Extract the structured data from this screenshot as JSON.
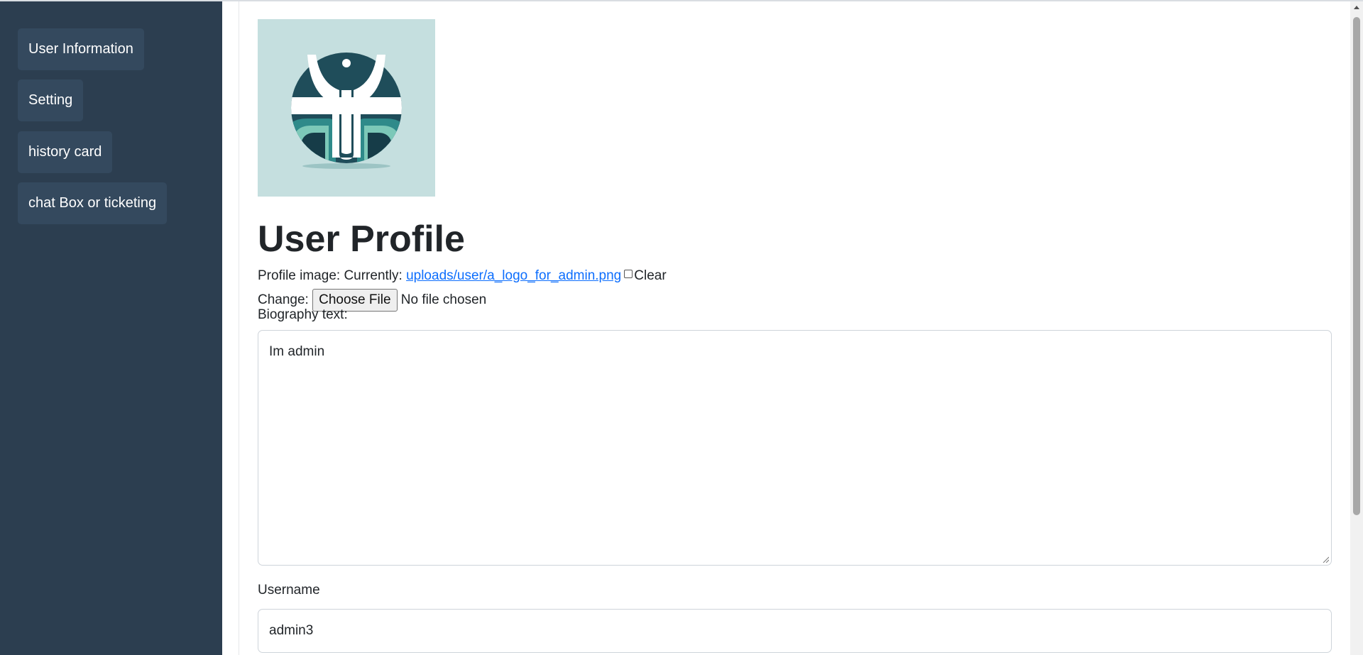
{
  "sidebar": {
    "items": [
      {
        "label": "User Information"
      },
      {
        "label": "Setting"
      },
      {
        "label": "history card"
      },
      {
        "label": "chat Box or ticketing"
      }
    ]
  },
  "profile": {
    "title": "User Profile",
    "image_label": "Profile image: Currently:",
    "image_link": "uploads/user/a_logo_for_admin.png",
    "clear_label": "Clear",
    "change_label": "Change:",
    "choose_file_label": "Choose File",
    "no_file_text": "No file chosen",
    "biography_label": "Biography text:",
    "biography_value": "Im admin",
    "username_label": "Username",
    "username_value": "admin3"
  },
  "colors": {
    "sidebar_bg": "#2c3e50",
    "sidebar_button_bg": "#34495e",
    "link": "#0d6efd",
    "avatar_bg": "#c5dfdf"
  }
}
